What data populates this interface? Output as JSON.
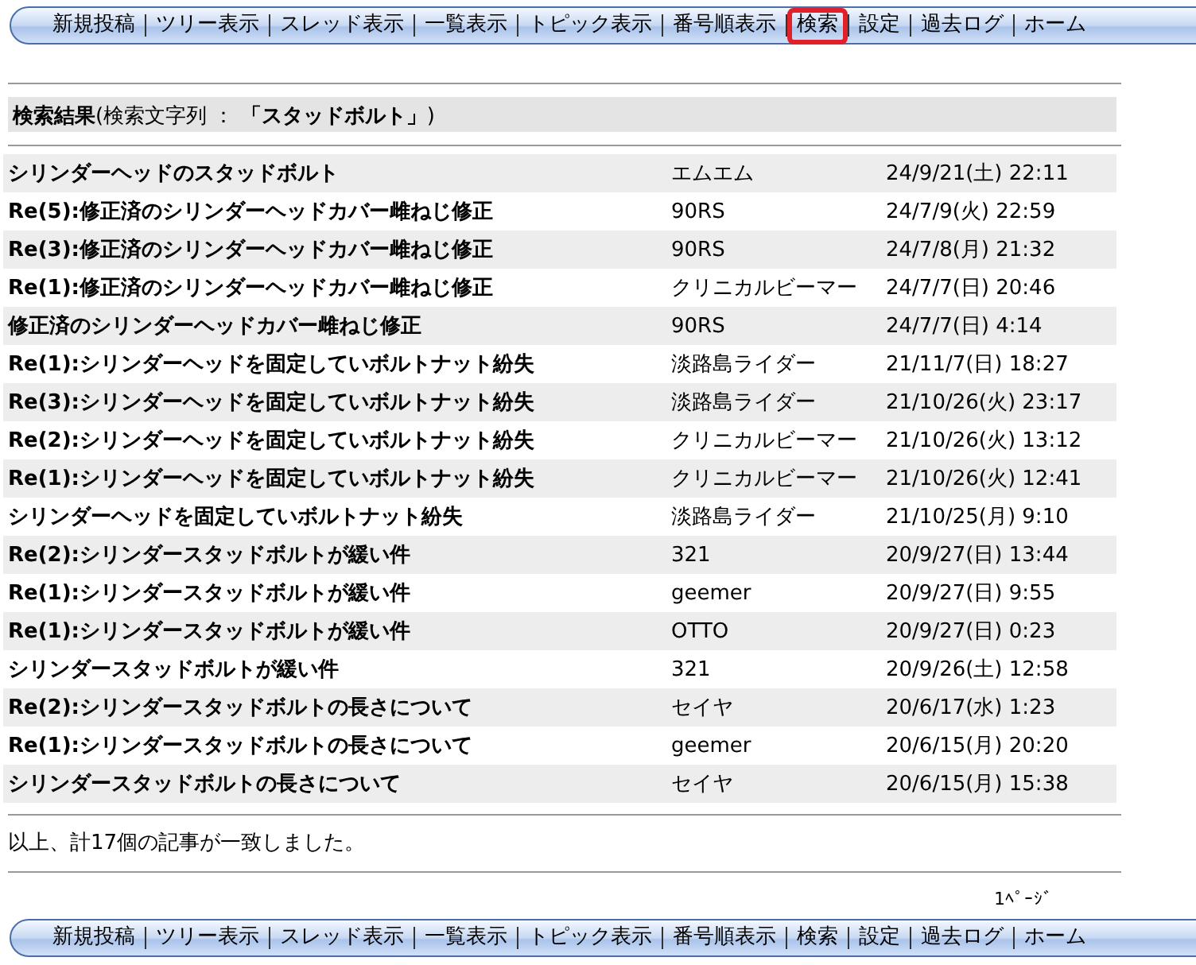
{
  "top_nav": [
    {
      "label": "新規投稿",
      "highlighted": false
    },
    {
      "label": "ツリー表示",
      "highlighted": false
    },
    {
      "label": "スレッド表示",
      "highlighted": false
    },
    {
      "label": "一覧表示",
      "highlighted": false
    },
    {
      "label": "トピック表示",
      "highlighted": false
    },
    {
      "label": "番号順表示",
      "highlighted": false
    },
    {
      "label": "検索",
      "highlighted": true
    },
    {
      "label": "設定",
      "highlighted": false
    },
    {
      "label": "過去ログ",
      "highlighted": false
    },
    {
      "label": "ホーム",
      "highlighted": false
    }
  ],
  "results_header": {
    "title": "検索結果",
    "query": "(検索文字列 ： **「スタッドボルト」**)"
  },
  "rows": [
    {
      "title": "シリンダーヘッドのスタッドボルト",
      "author": "エムエム",
      "date": "24/9/21(土) 22:11"
    },
    {
      "title": "Re(5):修正済のシリンダーヘッドカバー雌ねじ修正",
      "author": "90RS",
      "date": "24/7/9(火) 22:59"
    },
    {
      "title": "Re(3):修正済のシリンダーヘッドカバー雌ねじ修正",
      "author": "90RS",
      "date": "24/7/8(月) 21:32"
    },
    {
      "title": "Re(1):修正済のシリンダーヘッドカバー雌ねじ修正",
      "author": "クリニカルビーマー",
      "date": "24/7/7(日) 20:46"
    },
    {
      "title": "修正済のシリンダーヘッドカバー雌ねじ修正",
      "author": "90RS",
      "date": "24/7/7(日) 4:14"
    },
    {
      "title": "Re(1):シリンダーヘッドを固定していボルトナット紛失",
      "author": "淡路島ライダー",
      "date": "21/11/7(日) 18:27"
    },
    {
      "title": "Re(3):シリンダーヘッドを固定していボルトナット紛失",
      "author": "淡路島ライダー",
      "date": "21/10/26(火) 23:17"
    },
    {
      "title": "Re(2):シリンダーヘッドを固定していボルトナット紛失",
      "author": "クリニカルビーマー",
      "date": "21/10/26(火) 13:12"
    },
    {
      "title": "Re(1):シリンダーヘッドを固定していボルトナット紛失",
      "author": "クリニカルビーマー",
      "date": "21/10/26(火) 12:41"
    },
    {
      "title": "シリンダーヘッドを固定していボルトナット紛失",
      "author": "淡路島ライダー",
      "date": "21/10/25(月) 9:10"
    },
    {
      "title": "Re(2):シリンダースタッドボルトが緩い件",
      "author": "321",
      "date": "20/9/27(日) 13:44"
    },
    {
      "title": "Re(1):シリンダースタッドボルトが緩い件",
      "author": "geemer",
      "date": "20/9/27(日) 9:55"
    },
    {
      "title": "Re(1):シリンダースタッドボルトが緩い件",
      "author": "OTTO",
      "date": "20/9/27(日) 0:23"
    },
    {
      "title": "シリンダースタッドボルトが緩い件",
      "author": "321",
      "date": "20/9/26(土) 12:58"
    },
    {
      "title": "Re(2):シリンダースタッドボルトの長さについて",
      "author": "セイヤ",
      "date": "20/6/17(水) 1:23"
    },
    {
      "title": "Re(1):シリンダースタッドボルトの長さについて",
      "author": "geemer",
      "date": "20/6/15(月) 20:20"
    },
    {
      "title": "シリンダースタッドボルトの長さについて",
      "author": "セイヤ",
      "date": "20/6/15(月) 15:38"
    }
  ],
  "summary": "以上、計17個の記事が一致しました。",
  "page_indicator": "1ﾍﾟｰｼﾞ",
  "bottom_nav": [
    {
      "label": "新規投稿"
    },
    {
      "label": "ツリー表示"
    },
    {
      "label": "スレッド表示"
    },
    {
      "label": "一覧表示"
    },
    {
      "label": "トピック表示"
    },
    {
      "label": "番号順表示"
    },
    {
      "label": "検索"
    },
    {
      "label": "設定"
    },
    {
      "label": "過去ログ"
    },
    {
      "label": "ホーム"
    }
  ]
}
